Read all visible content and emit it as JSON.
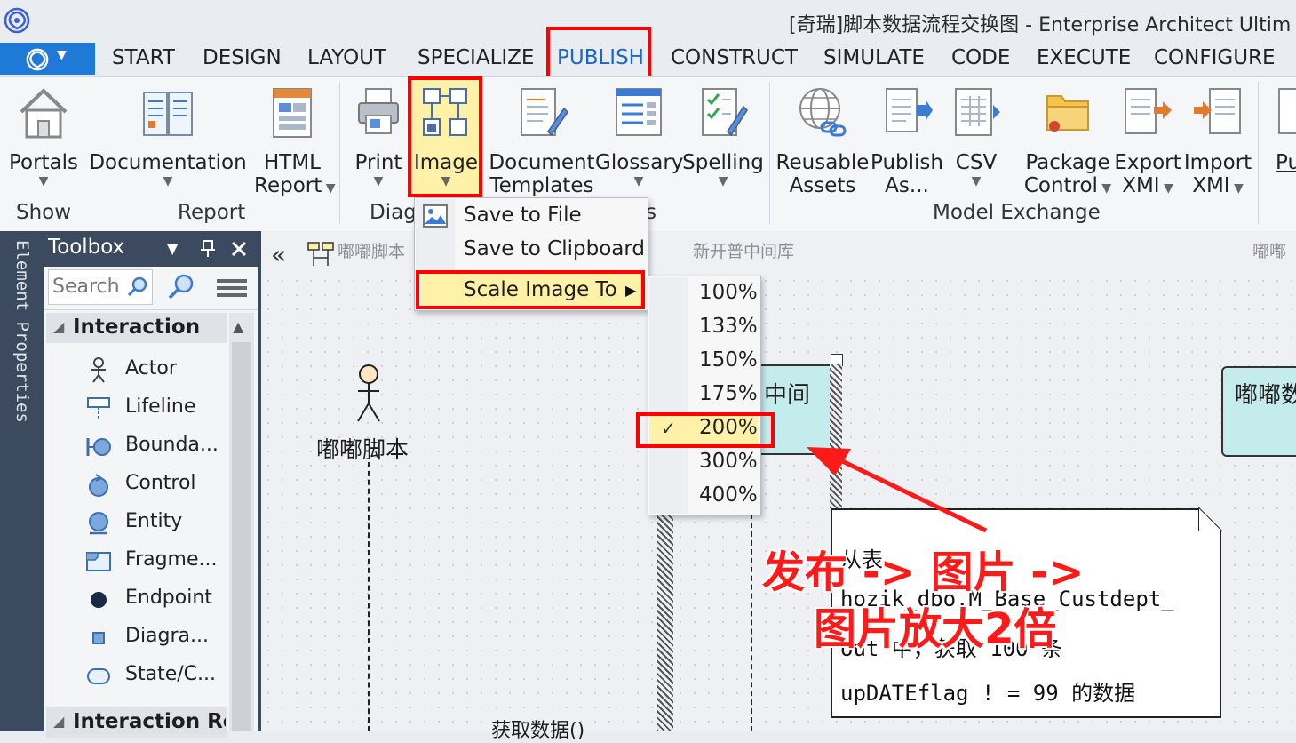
{
  "window": {
    "title": "[奇瑞]脚本数据流程交换图 - Enterprise Architect Ultim"
  },
  "tabs": [
    "START",
    "DESIGN",
    "LAYOUT",
    "SPECIALIZE",
    "PUBLISH",
    "CONSTRUCT",
    "SIMULATE",
    "CODE",
    "EXECUTE",
    "CONFIGURE"
  ],
  "active_tab": "PUBLISH",
  "ribbon": {
    "portals": "Portals",
    "documentation": "Documentation",
    "html_report_1": "HTML",
    "html_report_2": "Report",
    "print": "Print",
    "image": "Image",
    "doc_templates_1": "Document",
    "doc_templates_2": "Templates",
    "glossary": "Glossary",
    "spelling": "Spelling",
    "reusable_1": "Reusable",
    "reusable_2": "Assets",
    "publish_as_1": "Publish",
    "publish_as_2": "As...",
    "csv": "CSV",
    "package_control_1": "Package",
    "package_control_2": "Control",
    "export_xmi_1": "Export",
    "export_xmi_2": "XMI",
    "import_xmi_1": "Import",
    "import_xmi_2": "XMI",
    "pu_cut": "Pu",
    "groups": {
      "show": "Show",
      "report": "Report",
      "diag": "Diag",
      "s_cut": "s",
      "model_exchange": "Model Exchange"
    }
  },
  "side_strip": {
    "label": "Element Properties"
  },
  "toolbox": {
    "title": "Toolbox",
    "search_placeholder": "Search",
    "section": "Interaction",
    "section2": "Interaction Rel",
    "items": [
      "Actor",
      "Lifeline",
      "Bounda...",
      "Control",
      "Entity",
      "Fragme...",
      "Endpoint",
      "Diagra...",
      "State/C..."
    ]
  },
  "diagram": {
    "tab_left": "嘟嘟脚本",
    "tab_mid": "新开普中间库",
    "tab_right": "嘟嘟",
    "actor_label": "嘟嘟脚本",
    "box_mid_text": "中间",
    "box_right_text": "嘟嘟数",
    "message_bottom": "获取数据()",
    "note_lines": [
      "从表",
      "hozik_dbo.M_Base_Custdept_",
      "out 中，获取 100 条",
      "upDATEflag ! = 99 的数据"
    ]
  },
  "image_menu": {
    "items": [
      "Save to File",
      "Save to Clipboard",
      "Scale Image To"
    ]
  },
  "scale_menu": {
    "options": [
      "100%",
      "133%",
      "150%",
      "175%",
      "200%",
      "300%",
      "400%"
    ],
    "selected": "200%"
  },
  "annotation": {
    "line1": "发布 -> 图片 ->",
    "line2": "图片放大2倍"
  },
  "colors": {
    "accent": "#1e7ad6",
    "highlight": "#fff2a8",
    "annotation_red": "#ff0000",
    "panel_dark": "#3b4a5e"
  }
}
